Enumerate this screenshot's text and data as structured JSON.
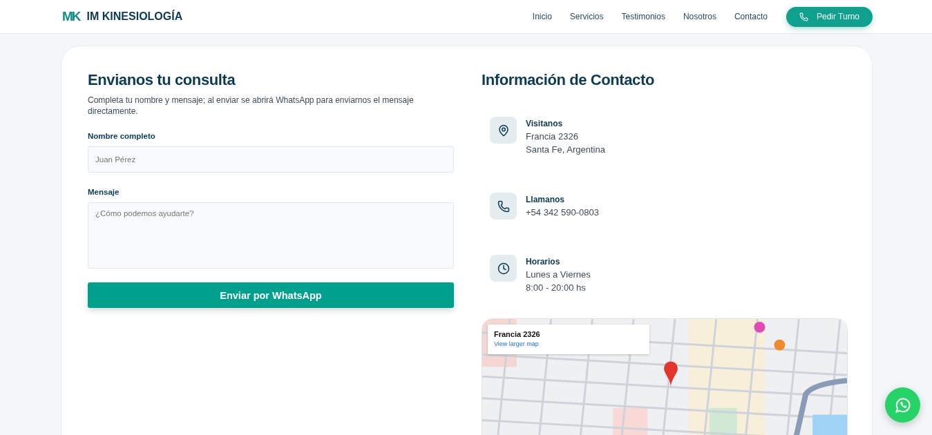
{
  "header": {
    "logo_mark": "MK",
    "brand": "IM KINESIOLOGÍA",
    "nav": [
      {
        "label": "Inicio"
      },
      {
        "label": "Servicios"
      },
      {
        "label": "Testimonios"
      },
      {
        "label": "Nosotros"
      },
      {
        "label": "Contacto"
      }
    ],
    "cta": "Pedir Turno"
  },
  "form": {
    "title": "Envianos tu consulta",
    "description": "Completa tu nombre y mensaje; al enviar se abrirá WhatsApp para enviarnos el mensaje directamente.",
    "fields": [
      {
        "kind": "input",
        "label": "Nombre completo",
        "placeholder": "Juan Pérez"
      },
      {
        "kind": "textarea",
        "label": "Mensaje",
        "placeholder": "¿Cómo podemos ayudarte?"
      }
    ],
    "submit": "Enviar por WhatsApp"
  },
  "contact": {
    "title": "Información de Contacto",
    "items": [
      {
        "kind": "location",
        "title": "Visitanos",
        "lines": [
          "Francia 2326",
          "Santa Fe, Argentina"
        ]
      },
      {
        "kind": "phone",
        "title": "Llamanos",
        "lines": [
          "+54 342 590-0803"
        ]
      },
      {
        "kind": "hours",
        "title": "Horarios",
        "lines": [
          "Lunes a Viernes",
          "8:00 - 20:00 hs"
        ]
      }
    ],
    "map": {
      "kind": "picture",
      "place": "Francia 2326",
      "link": "View larger map"
    }
  }
}
